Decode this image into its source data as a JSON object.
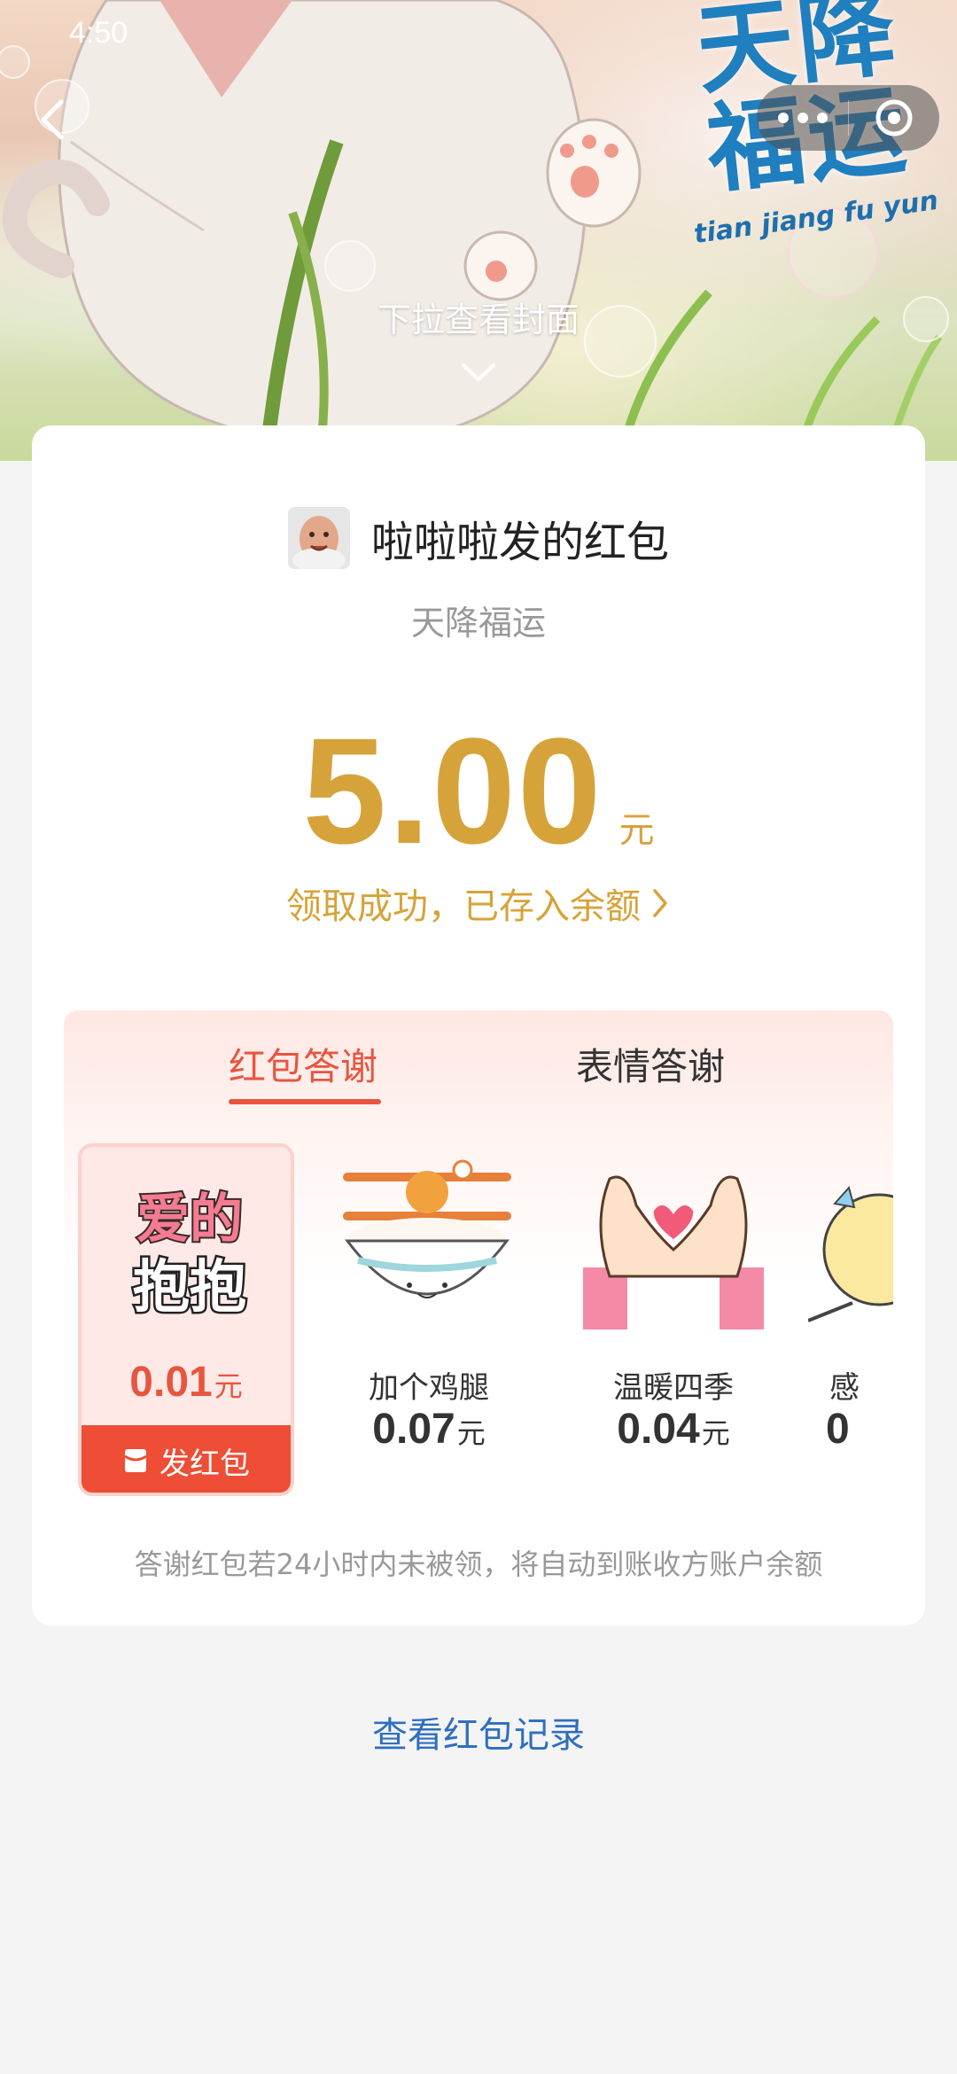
{
  "status_bar": {
    "time": "4:50"
  },
  "cover": {
    "title_line1": "天降",
    "title_line2": "福运",
    "subtitle": "tian jiang fu yun",
    "pull_hint": "下拉查看封面"
  },
  "header": {
    "more_icon": "more-dots-icon",
    "close_icon": "target-close-icon",
    "back_icon": "chevron-left-icon"
  },
  "packet": {
    "sender_title": "啦啦啦发的红包",
    "wish": "天降福运",
    "amount": "5.00",
    "amount_unit": "元",
    "success_text": "领取成功，已存入余额"
  },
  "thanks": {
    "tabs": [
      {
        "label": "红包答谢",
        "active": true
      },
      {
        "label": "表情答谢",
        "active": false
      }
    ],
    "gifts": [
      {
        "name": "爱的抱抱",
        "price": "0.01",
        "unit": "元",
        "selected": true,
        "button": "发红包"
      },
      {
        "name": "加个鸡腿",
        "price": "0.07",
        "unit": "元"
      },
      {
        "name": "温暖四季",
        "price": "0.04",
        "unit": "元"
      },
      {
        "name": "感",
        "price": "0",
        "unit": ""
      }
    ],
    "sticker_text_1": "爱的",
    "sticker_text_2": "抱抱"
  },
  "notice": "答谢红包若24小时内未被领，将自动到账收方账户余额",
  "records_link": "查看红包记录",
  "colors": {
    "gold": "#d6a33a",
    "red": "#e8553f",
    "link": "#2f6ec0"
  }
}
